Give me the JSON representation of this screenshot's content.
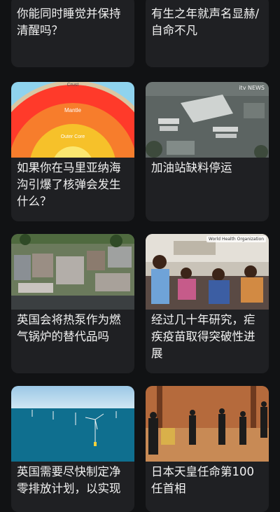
{
  "cards": [
    {
      "title": "你能同时睡觉并保持清醒吗？"
    },
    {
      "title": "有生之年就声名显赫/自命不凡"
    },
    {
      "title": "如果你在马里亚纳海沟引爆了核弹会发生什么？",
      "image": {
        "labels": [
          "Crust",
          "Mantle",
          "Outer Core"
        ]
      }
    },
    {
      "title": "加油站缺料停运",
      "image": {
        "watermark": "itv NEWS"
      }
    },
    {
      "title": "英国会将热泵作为燃气锅炉的替代品吗"
    },
    {
      "title": "经过几十年研究，疟疾疫苗取得突破性进展",
      "image": {
        "watermark": "World Health Organization"
      }
    },
    {
      "title": "英国需要尽快制定净零排放计划，以实现"
    },
    {
      "title": "日本天皇任命第100任首相"
    }
  ],
  "colors": {
    "background": "#111214",
    "card": "#1f2023",
    "text": "#f2f2f2"
  }
}
